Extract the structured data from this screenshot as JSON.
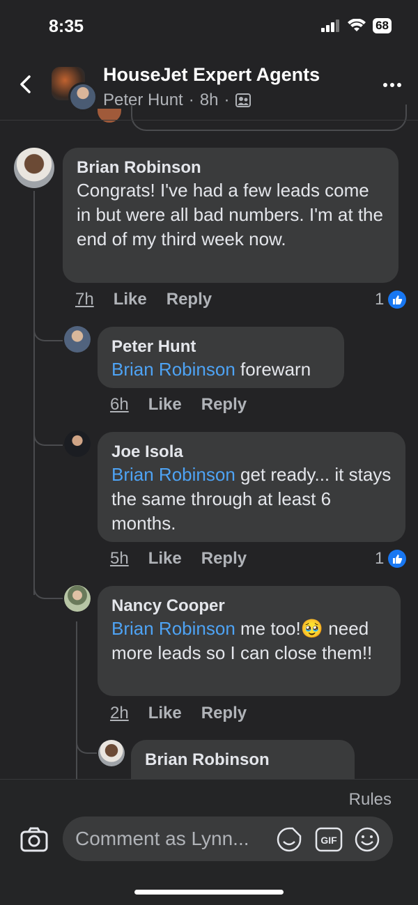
{
  "status": {
    "time": "8:35",
    "battery": "68"
  },
  "header": {
    "group_name": "HouseJet Expert Agents",
    "author": "Peter Hunt",
    "sep": "·",
    "age": "8h"
  },
  "comments": [
    {
      "author": "Brian Robinson",
      "text": "Congrats! I've had a few leads come in but were all bad numbers. I'm at the end of my third week now.",
      "time": "7h",
      "like": "Like",
      "reply": "Reply",
      "reactions": "1"
    },
    {
      "author": "Peter Hunt",
      "mention": "Brian Robinson",
      "text": " forewarn",
      "time": "6h",
      "like": "Like",
      "reply": "Reply"
    },
    {
      "author": "Joe Isola",
      "mention": "Brian Robinson",
      "text": " get ready... it stays the same through at least 6 months.",
      "time": "5h",
      "like": "Like",
      "reply": "Reply",
      "reactions": "1"
    },
    {
      "author": "Nancy Cooper",
      "mention": "Brian Robinson",
      "text": " me too!🥹 need more leads so I can close them!!",
      "time": "2h",
      "like": "Like",
      "reply": "Reply"
    },
    {
      "author": "Brian Robinson"
    }
  ],
  "footer": {
    "rules": "Rules",
    "comment_placeholder": "Comment as Lynn..."
  },
  "colors": {
    "background": "#232325",
    "bubble": "#3a3b3c",
    "mention": "#4ea3f4",
    "like": "#1877f2"
  }
}
